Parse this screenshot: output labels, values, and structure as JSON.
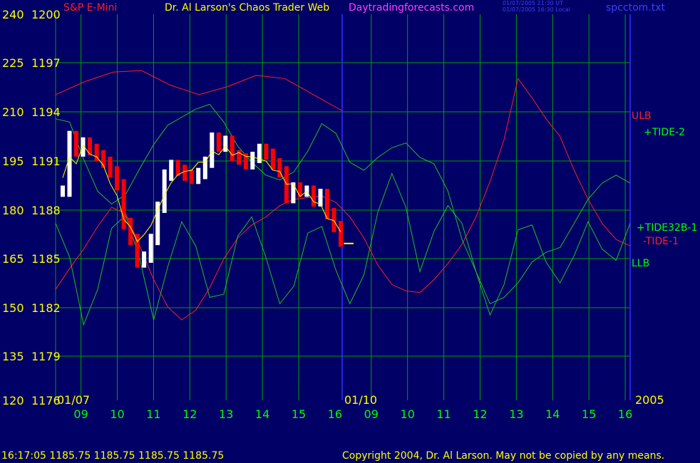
{
  "header": {
    "symbol": "S&P E-Mini",
    "title": "Dr. Al Larson's Chaos Trader Web",
    "site": "Daytradingforecasts.com",
    "stamp_ut": "01/07/2005 21:30 UT",
    "stamp_local": "01/07/2005 16:30 Local",
    "file": "spcctom.txt"
  },
  "footer": {
    "quote": "16:17:05  1185.75 1185.75 1185.75 1185.75",
    "copyright": "Copyright 2004, Dr. Al Larson. May not be copied by any means."
  },
  "colors": {
    "background": "#000066",
    "grid": "#00a000",
    "price_up": "#ffffff",
    "price_down": "#ff0000",
    "tide_red": "#ff2020",
    "tide_green": "#20c020",
    "blue_line": "#3030ff",
    "yellow_line": "#ffff00",
    "label_yellow": "#ffff00",
    "label_green": "#00ff00"
  },
  "chart_data": {
    "type": "line",
    "y_left_ticks": [
      "240",
      "225",
      "210",
      "195",
      "180",
      "165",
      "150",
      "135",
      "120"
    ],
    "y_price_ticks": [
      "1200",
      "1197",
      "1194",
      "1191",
      "1188",
      "1185",
      "1182",
      "1179",
      "1176"
    ],
    "x_ticks": [
      "09",
      "10",
      "11",
      "12",
      "13",
      "14",
      "15",
      "16",
      "09",
      "10",
      "11",
      "12",
      "13",
      "14",
      "15",
      "16"
    ],
    "date_labels": [
      "01/07",
      "01/10",
      "2005"
    ],
    "series_labels": [
      "ULB",
      "+TIDE-2",
      "+TIDE32B-1",
      "-TIDE-1",
      "LLB"
    ],
    "price_ylim": [
      1176,
      1200
    ],
    "last_price": 1185.75,
    "price_series": [
      1189.0,
      1192.4,
      1191.5,
      1192.0,
      1191.6,
      1191.2,
      1190.8,
      1190.2,
      1189.4,
      1187.0,
      1186.0,
      1184.6,
      1184.9,
      1186.0,
      1188.0,
      1190.0,
      1190.6,
      1190.3,
      1190.0,
      1189.8,
      1190.1,
      1190.8,
      1192.3,
      1191.8,
      1192.1,
      1191.2,
      1191.0,
      1190.7,
      1191.1,
      1191.6,
      1191.3,
      1190.7,
      1190.2,
      1188.6,
      1189.2,
      1189.0,
      1189.0,
      1188.4,
      1188.8,
      1187.6,
      1186.8,
      1185.9
    ],
    "tide_plus_2": [
      1193.5,
      1193.3,
      1191.0,
      1189.0,
      1188.2,
      1188.8,
      1190.4,
      1191.9,
      1193.1,
      1193.6,
      1194.1,
      1194.4,
      1193.3,
      1191.8,
      1190.8,
      1190.0,
      1189.7,
      1190.2,
      1191.5,
      1193.2,
      1192.6,
      1190.8,
      1190.3,
      1191.1,
      1191.7,
      1192.0,
      1191.1,
      1190.7,
      1189.0,
      1186.0,
      1184.0,
      1182.0,
      1182.4,
      1183.3,
      1184.6,
      1185.2,
      1185.5,
      1187.0,
      1188.5,
      1189.5,
      1190.0,
      1189.5
    ],
    "tide_minus_1": [
      1182.9,
      1184.2,
      1185.4,
      1186.8,
      1188.0,
      1187.6,
      1185.6,
      1183.5,
      1181.8,
      1181.0,
      1181.6,
      1183.0,
      1184.8,
      1186.1,
      1186.9,
      1187.4,
      1188.1,
      1188.5,
      1188.6,
      1188.7,
      1188.3,
      1187.4,
      1186.1,
      1184.4,
      1183.2,
      1182.8,
      1182.7,
      1183.5,
      1184.5,
      1185.7,
      1187.4,
      1189.6,
      1192.2,
      1196.0,
      1194.8,
      1193.5,
      1192.4,
      1190.3,
      1188.5,
      1187.0,
      1186.0,
      1185.6
    ],
    "tide32b_1": [
      1187.0,
      1184.9,
      1180.7,
      1182.9,
      1186.7,
      1187.5,
      1184.8,
      1181.0,
      1184.3,
      1187.1,
      1185.6,
      1182.4,
      1182.6,
      1186.2,
      1187.4,
      1184.9,
      1182.0,
      1183.1,
      1186.4,
      1186.8,
      1184.1,
      1182.0,
      1183.8,
      1187.7,
      1190.1,
      1188.0,
      1184.0,
      1186.5,
      1188.1,
      1187.0,
      1184.0,
      1181.3,
      1183.2,
      1186.6,
      1186.9,
      1184.6,
      1183.3,
      1185.0,
      1187.1,
      1185.4,
      1184.7,
      1187.0
    ],
    "ulb": [
      1195.0,
      1195.8,
      1196.4,
      1196.5,
      1195.6,
      1195.0,
      1195.5,
      1196.2,
      1196.0,
      1195.0,
      1194.0
    ]
  }
}
